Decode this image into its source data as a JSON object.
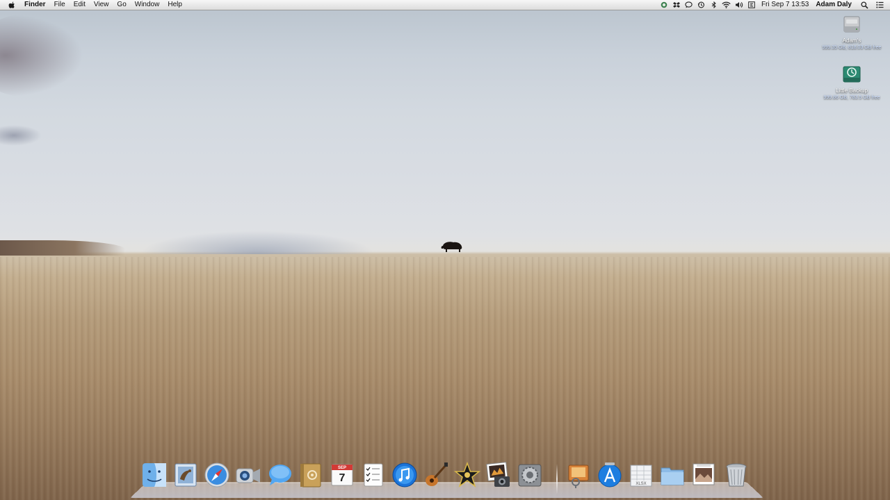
{
  "menubar": {
    "app_name": "Finder",
    "menus": [
      "File",
      "Edit",
      "View",
      "Go",
      "Window",
      "Help"
    ],
    "clock": "Fri Sep 7  13:53",
    "user": "Adam Daly",
    "status_icons": [
      "evernote-icon",
      "dropbox-icon",
      "chat-bubble-icon",
      "time-machine-icon",
      "bluetooth-icon",
      "wifi-icon",
      "volume-icon",
      "input-menu-icon"
    ]
  },
  "desktop": {
    "drives": [
      {
        "name": "Adam's ",
        "info": "999.35 GB, 818.03 GB free"
      },
      {
        "name": "Little Backup",
        "info": "999.86 GB, 783.5 GB free"
      }
    ]
  },
  "dock": {
    "items": [
      "finder-icon",
      "mail-icon",
      "safari-icon",
      "facetime-icon",
      "messages-icon",
      "address-book-icon",
      "ical-icon",
      "reminders-icon",
      "itunes-icon",
      "garageband-icon",
      "imovie-icon",
      "iphoto-icon",
      "system-preferences-icon",
      "preview-icon",
      "app-store-icon",
      "xlsx-document-icon",
      "folder-icon",
      "photo-stack-icon",
      "trash-icon"
    ],
    "ical": {
      "month": "SEP",
      "day": "7"
    }
  },
  "colors": {
    "menubar_bg": "#e8e8e8",
    "selection_blue": "#2a6fd6",
    "drive_label_sub": "#cfe0ff"
  }
}
